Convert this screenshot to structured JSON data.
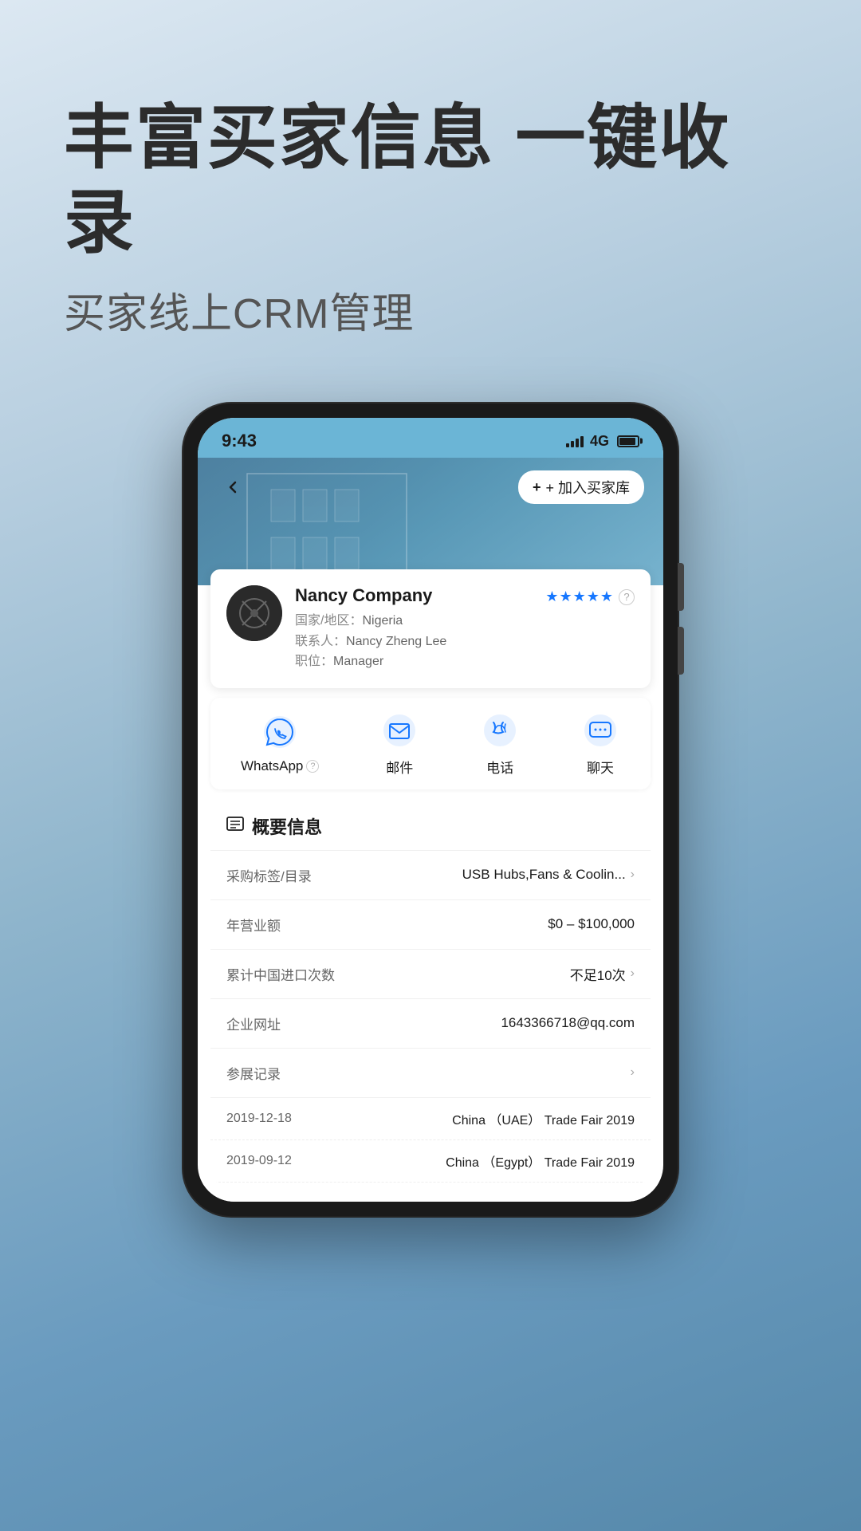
{
  "header": {
    "main_title": "丰富买家信息 一键收录",
    "sub_title": "买家线上CRM管理"
  },
  "phone": {
    "status_bar": {
      "time": "9:43",
      "network": "4G"
    },
    "nav": {
      "add_buyer_label": "+ 加入买家库"
    },
    "company": {
      "name": "Nancy Company",
      "country_label": "国家/地区：",
      "country": "Nigeria",
      "contact_label": "联系人：",
      "contact": "Nancy Zheng Lee",
      "title_label": "职位：",
      "title": "Manager",
      "rating": "★★★★★",
      "rating_partial": "☆"
    },
    "actions": [
      {
        "id": "whatsapp",
        "label": "WhatsApp",
        "has_help": true
      },
      {
        "id": "email",
        "label": "邮件",
        "has_help": false
      },
      {
        "id": "phone",
        "label": "电话",
        "has_help": false
      },
      {
        "id": "chat",
        "label": "聊天",
        "has_help": false
      }
    ],
    "overview": {
      "section_title": "概要信息",
      "rows": [
        {
          "label": "采购标签/目录",
          "value": "USB Hubs,Fans & Coolin...",
          "has_chevron": true
        },
        {
          "label": "年营业额",
          "value": "$0 – $100,000",
          "has_chevron": false
        },
        {
          "label": "累计中国进口次数",
          "value": "不足10次",
          "has_chevron": true
        },
        {
          "label": "企业网址",
          "value": "1643366718@qq.com",
          "has_chevron": false
        },
        {
          "label": "参展记录",
          "value": "",
          "has_chevron": true
        }
      ],
      "trade_fairs": [
        {
          "date": "2019-12-18",
          "event": "China （UAE） Trade Fair 2019"
        },
        {
          "date": "2019-09-12",
          "event": "China （Egypt） Trade Fair 2019"
        }
      ]
    }
  }
}
